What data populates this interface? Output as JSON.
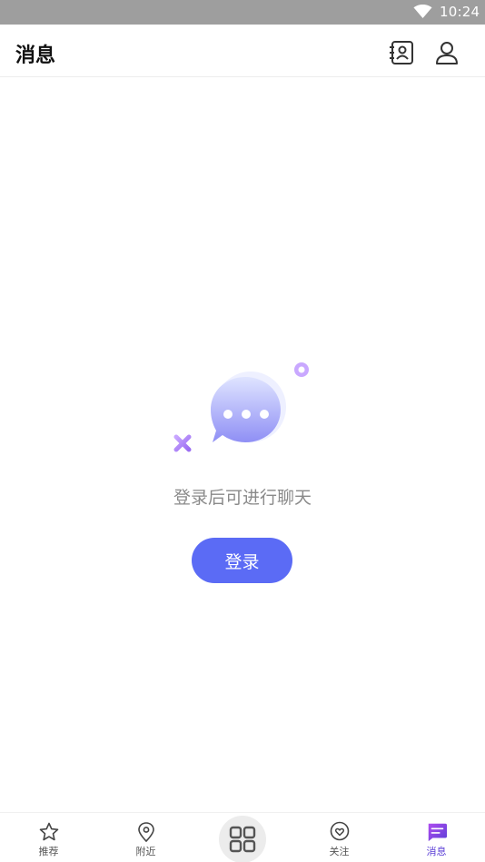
{
  "status_bar": {
    "time": "10:24",
    "wifi_icon": "wifi-icon"
  },
  "header": {
    "title": "消息",
    "contacts_icon": "contacts-book-icon",
    "user_icon": "user-icon"
  },
  "empty_state": {
    "illustration": "chat-bubble-illustration",
    "message": "登录后可进行聊天",
    "login_label": "登录"
  },
  "tabbar": {
    "items": [
      {
        "label": "推荐",
        "icon": "star-icon"
      },
      {
        "label": "附近",
        "icon": "location-pin-icon"
      },
      {
        "label": "",
        "icon": "grid-icon"
      },
      {
        "label": "关注",
        "icon": "heart-pin-icon"
      },
      {
        "label": "消息",
        "icon": "message-icon",
        "active": true
      }
    ]
  },
  "colors": {
    "accent": "#5b6bf5",
    "active_tab": "#5b3fd6",
    "status_bar": "#9e9e9e"
  }
}
